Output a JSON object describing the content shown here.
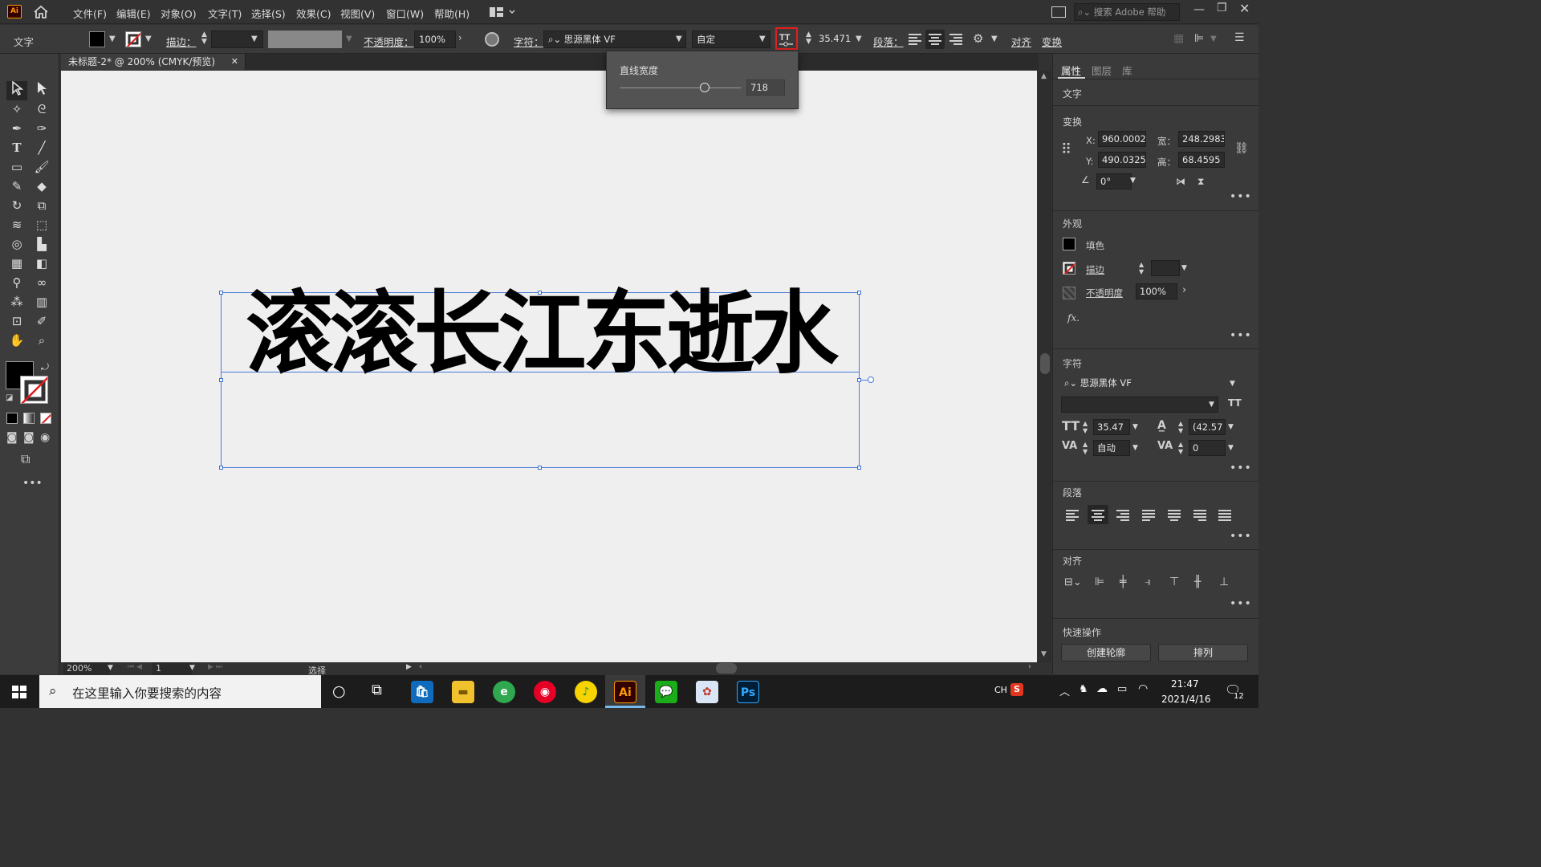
{
  "app": {
    "logo": "Ai",
    "accent": "#ff9a00",
    "logo_bg": "#330000"
  },
  "menu": {
    "items": [
      "文件(F)",
      "编辑(E)",
      "对象(O)",
      "文字(T)",
      "选择(S)",
      "效果(C)",
      "视图(V)",
      "窗口(W)",
      "帮助(H)"
    ],
    "search_placeholder": "搜索 Adobe 帮助"
  },
  "control_bar": {
    "mode_label": "文字",
    "stroke_label": "描边：",
    "opacity_label": "不透明度：",
    "opacity_value": "100%",
    "character_label": "字符：",
    "font_family": "思源黑体 VF",
    "font_style": "自定",
    "font_size": "35.471",
    "paragraph_label": "段落：",
    "align_label": "对齐",
    "transform_label": "变换"
  },
  "popup": {
    "title": "直线宽度",
    "value": "718",
    "slider_fraction": 0.7
  },
  "document": {
    "tab_title": "未标题-2* @ 200% (CMYK/预览)",
    "close_symbol": "✕"
  },
  "canvas": {
    "text": "滚滚长江东逝水",
    "selection_color": "#4a7bd8"
  },
  "status": {
    "zoom": "200%",
    "page": "1",
    "tool": "选择"
  },
  "panel": {
    "tabs": [
      "属性",
      "图层",
      "库"
    ],
    "object_type": "文字",
    "transform": {
      "title": "变换",
      "x_label": "X:",
      "x": "960.0002",
      "y_label": "Y:",
      "y": "490.0325",
      "w_label": "宽：",
      "w": "248.2983",
      "h_label": "高：",
      "h": "68.4595",
      "angle": "0°"
    },
    "appearance": {
      "title": "外观",
      "fill_label": "填色",
      "stroke_label": "描边",
      "opacity_label": "不透明度",
      "opacity": "100%",
      "fx": "fx."
    },
    "character": {
      "title": "字符",
      "font": "思源黑体 VF",
      "size": "35.47",
      "leading": "(42.57",
      "tracking_auto": "自动",
      "tracking": "0"
    },
    "paragraph": {
      "title": "段落"
    },
    "align": {
      "title": "对齐"
    },
    "quick_actions": {
      "title": "快速操作",
      "create_outlines": "创建轮廓",
      "arrange": "排列"
    }
  },
  "taskbar": {
    "search_placeholder": "在这里输入你要搜索的内容",
    "ime": "CH",
    "time": "21:47",
    "date": "2021/4/16",
    "notifications": "12"
  }
}
